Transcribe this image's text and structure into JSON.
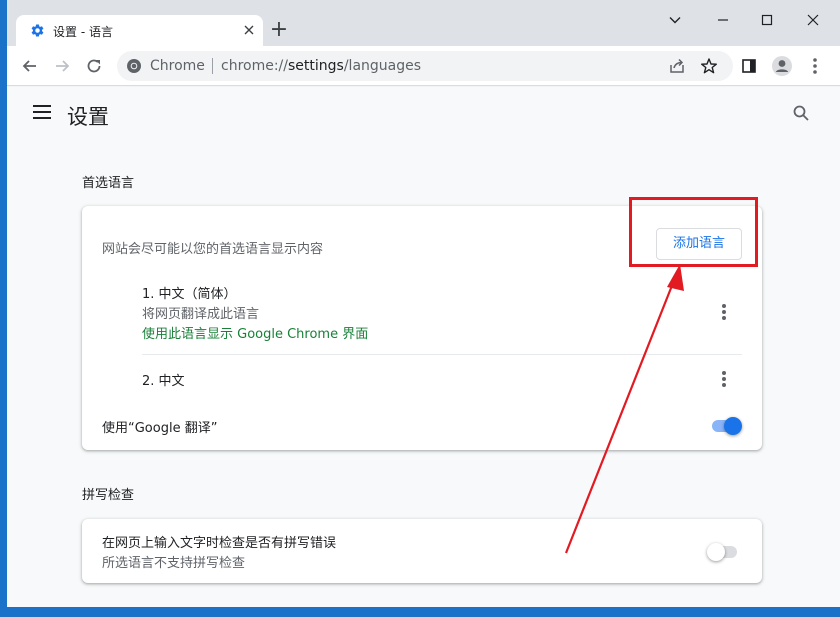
{
  "browser": {
    "tab": {
      "title": "设置 - 语言",
      "icon": "gear-icon"
    },
    "new_tab": "+",
    "window_controls": {
      "minimize": "—",
      "maximize": "☐",
      "close": "✕",
      "menu": "⌄"
    },
    "omnibox": {
      "site_label": "Chrome",
      "url_scheme": "chrome://",
      "url_host": "settings",
      "url_path": "/languages"
    }
  },
  "settings": {
    "title": "设置",
    "preferred_languages": {
      "section_title": "首选语言",
      "description": "网站会尽可能以您的首选语言显示内容",
      "add_button": "添加语言",
      "languages": [
        {
          "name": "1. 中文（简体）",
          "subtitle": "将网页翻译成此语言",
          "note": "使用此语言显示 Google Chrome 界面"
        },
        {
          "name": "2. 中文"
        }
      ],
      "translate_label": "使用“Google 翻译”",
      "translate_enabled": true
    },
    "spell_check": {
      "section_title": "拼写检查",
      "label": "在网页上输入文字时检查是否有拼写错误",
      "sublabel": "所选语言不支持拼写检查",
      "enabled": false
    }
  },
  "colors": {
    "accent": "#1a73e8",
    "annotation": "#e21a22",
    "link_green": "#188038"
  }
}
